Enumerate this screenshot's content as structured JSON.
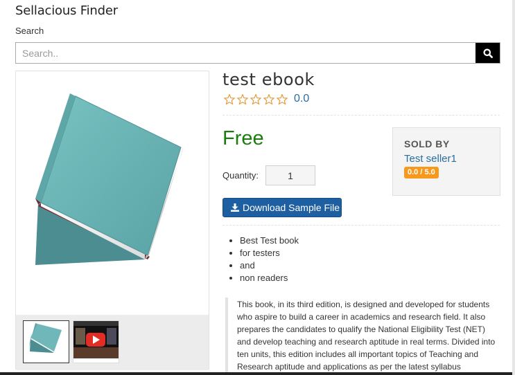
{
  "finder": {
    "title": "Sellacious Finder"
  },
  "search": {
    "label": "Search",
    "placeholder": "Search..",
    "button_icon": "search-icon"
  },
  "product": {
    "title": "test ebook",
    "rating": {
      "stars": 0,
      "max_stars": 5,
      "value": "0.0"
    },
    "price": "Free",
    "quantity": {
      "label": "Quantity:",
      "value": "1"
    },
    "download_button": {
      "label": "Download Sample File",
      "icon": "download-icon"
    },
    "features": [
      "Best Test book",
      "for testers",
      "and",
      "non readers"
    ],
    "description": "This book, in its third edition, is designed and developed for students who aspire to build a career in academics and research field. It also prepares the candidates to qualify the National Eligibility Test (NET) and develop teaching and research aptitude in real terms. Divided into ten units, this edition includes all important topics of Teaching and Research aptitude and applications as per the latest syllabus"
  },
  "seller": {
    "heading": "SOLD BY",
    "name": "Test seller1",
    "rating": "0.0 / 5.0"
  },
  "gallery": {
    "main_image": "book-image",
    "thumbnails": [
      {
        "type": "book-image",
        "selected": true
      },
      {
        "type": "video-thumbnail",
        "selected": false
      }
    ]
  },
  "colors": {
    "price": "#1a7d0d",
    "link": "#2a6da0",
    "button": "#1d5fa0",
    "badge": "#f6991d",
    "star": "#e39b3c"
  }
}
